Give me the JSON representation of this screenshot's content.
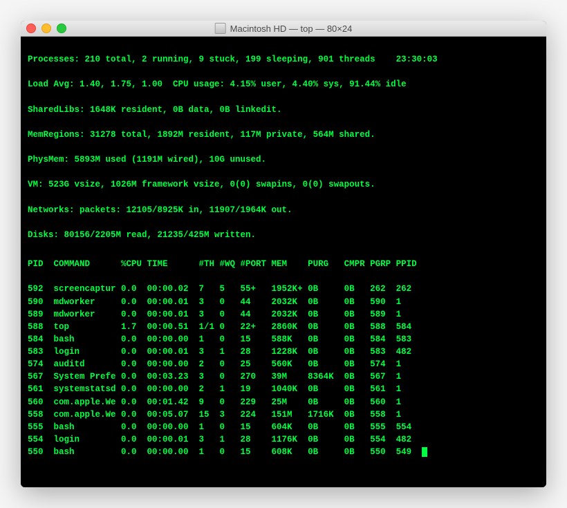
{
  "window": {
    "title": "Macintosh HD — top — 80×24"
  },
  "header": {
    "processes": "Processes: 210 total, 2 running, 9 stuck, 199 sleeping, 901 threads    23:30:03",
    "load": "Load Avg: 1.40, 1.75, 1.00  CPU usage: 4.15% user, 4.40% sys, 91.44% idle",
    "sharedlibs": "SharedLibs: 1648K resident, 0B data, 0B linkedit.",
    "memregions": "MemRegions: 31278 total, 1892M resident, 117M private, 564M shared.",
    "physmem": "PhysMem: 5893M used (1191M wired), 10G unused.",
    "vm": "VM: 523G vsize, 1026M framework vsize, 0(0) swapins, 0(0) swapouts.",
    "networks": "Networks: packets: 12105/8925K in, 11907/1964K out.",
    "disks": "Disks: 80156/2205M read, 21235/425M written."
  },
  "columns": [
    "PID",
    "COMMAND",
    "%CPU",
    "TIME",
    "#TH",
    "#WQ",
    "#PORT",
    "MEM",
    "PURG",
    "CMPR",
    "PGRP",
    "PPID"
  ],
  "rows": [
    {
      "pid": "592",
      "command": "screencaptur",
      "cpu": "0.0",
      "time": "00:00.02",
      "th": "7",
      "wq": "5",
      "port": "55+",
      "mem": "1952K+",
      "purg": "0B",
      "cmpr": "0B",
      "pgrp": "262",
      "ppid": "262"
    },
    {
      "pid": "590",
      "command": "mdworker",
      "cpu": "0.0",
      "time": "00:00.01",
      "th": "3",
      "wq": "0",
      "port": "44",
      "mem": "2032K",
      "purg": "0B",
      "cmpr": "0B",
      "pgrp": "590",
      "ppid": "1"
    },
    {
      "pid": "589",
      "command": "mdworker",
      "cpu": "0.0",
      "time": "00:00.01",
      "th": "3",
      "wq": "0",
      "port": "44",
      "mem": "2032K",
      "purg": "0B",
      "cmpr": "0B",
      "pgrp": "589",
      "ppid": "1"
    },
    {
      "pid": "588",
      "command": "top",
      "cpu": "1.7",
      "time": "00:00.51",
      "th": "1/1",
      "wq": "0",
      "port": "22+",
      "mem": "2860K",
      "purg": "0B",
      "cmpr": "0B",
      "pgrp": "588",
      "ppid": "584"
    },
    {
      "pid": "584",
      "command": "bash",
      "cpu": "0.0",
      "time": "00:00.00",
      "th": "1",
      "wq": "0",
      "port": "15",
      "mem": "588K",
      "purg": "0B",
      "cmpr": "0B",
      "pgrp": "584",
      "ppid": "583"
    },
    {
      "pid": "583",
      "command": "login",
      "cpu": "0.0",
      "time": "00:00.01",
      "th": "3",
      "wq": "1",
      "port": "28",
      "mem": "1228K",
      "purg": "0B",
      "cmpr": "0B",
      "pgrp": "583",
      "ppid": "482"
    },
    {
      "pid": "574",
      "command": "auditd",
      "cpu": "0.0",
      "time": "00:00.00",
      "th": "2",
      "wq": "0",
      "port": "25",
      "mem": "560K",
      "purg": "0B",
      "cmpr": "0B",
      "pgrp": "574",
      "ppid": "1"
    },
    {
      "pid": "567",
      "command": "System Prefe",
      "cpu": "0.0",
      "time": "00:03.23",
      "th": "3",
      "wq": "0",
      "port": "270",
      "mem": "39M",
      "purg": "8364K",
      "cmpr": "0B",
      "pgrp": "567",
      "ppid": "1"
    },
    {
      "pid": "561",
      "command": "systemstatsd",
      "cpu": "0.0",
      "time": "00:00.00",
      "th": "2",
      "wq": "1",
      "port": "19",
      "mem": "1040K",
      "purg": "0B",
      "cmpr": "0B",
      "pgrp": "561",
      "ppid": "1"
    },
    {
      "pid": "560",
      "command": "com.apple.We",
      "cpu": "0.0",
      "time": "00:01.42",
      "th": "9",
      "wq": "0",
      "port": "229",
      "mem": "25M",
      "purg": "0B",
      "cmpr": "0B",
      "pgrp": "560",
      "ppid": "1"
    },
    {
      "pid": "558",
      "command": "com.apple.We",
      "cpu": "0.0",
      "time": "00:05.07",
      "th": "15",
      "wq": "3",
      "port": "224",
      "mem": "151M",
      "purg": "1716K",
      "cmpr": "0B",
      "pgrp": "558",
      "ppid": "1"
    },
    {
      "pid": "555",
      "command": "bash",
      "cpu": "0.0",
      "time": "00:00.00",
      "th": "1",
      "wq": "0",
      "port": "15",
      "mem": "604K",
      "purg": "0B",
      "cmpr": "0B",
      "pgrp": "555",
      "ppid": "554"
    },
    {
      "pid": "554",
      "command": "login",
      "cpu": "0.0",
      "time": "00:00.01",
      "th": "3",
      "wq": "1",
      "port": "28",
      "mem": "1176K",
      "purg": "0B",
      "cmpr": "0B",
      "pgrp": "554",
      "ppid": "482"
    },
    {
      "pid": "550",
      "command": "bash",
      "cpu": "0.0",
      "time": "00:00.00",
      "th": "1",
      "wq": "0",
      "port": "15",
      "mem": "608K",
      "purg": "0B",
      "cmpr": "0B",
      "pgrp": "550",
      "ppid": "549"
    }
  ]
}
